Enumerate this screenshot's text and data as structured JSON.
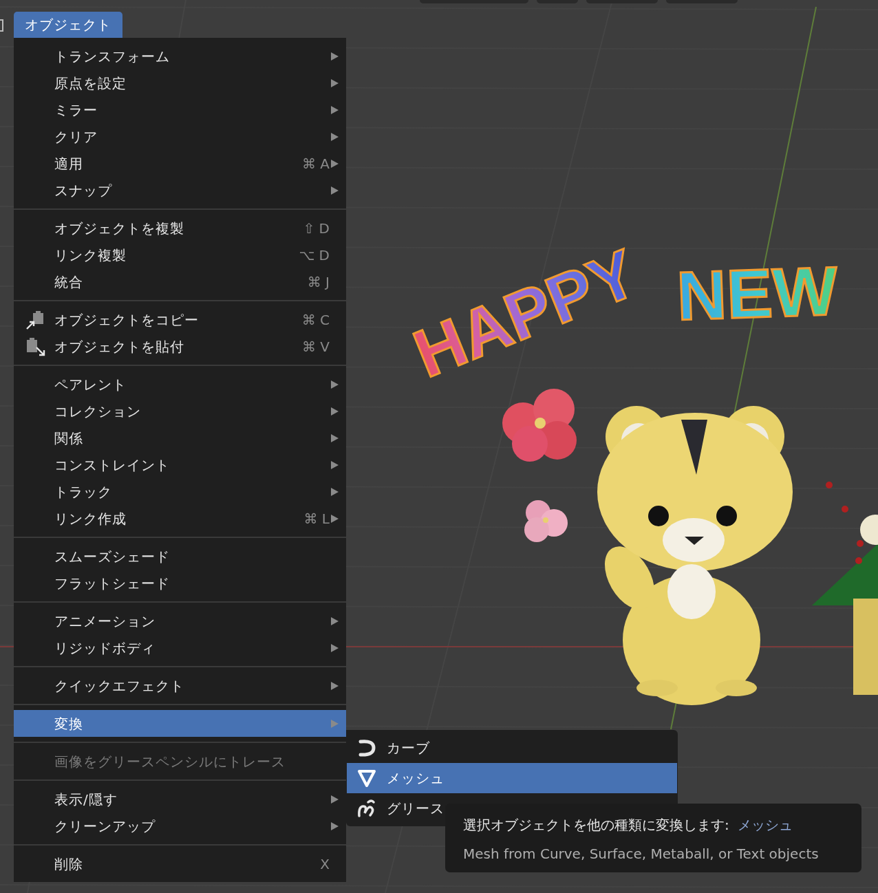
{
  "header_menu": {
    "label": "オブジェクト",
    "selected": true
  },
  "menu": {
    "groups": [
      {
        "items": [
          {
            "label": "トランスフォーム",
            "submenu": true,
            "selected": false,
            "disabled": false
          },
          {
            "label": "原点を設定",
            "submenu": true,
            "selected": false,
            "disabled": false
          },
          {
            "label": "ミラー",
            "submenu": true,
            "selected": false,
            "disabled": false
          },
          {
            "label": "クリア",
            "submenu": true,
            "selected": false,
            "disabled": false
          },
          {
            "label": "適用",
            "shortcut": "⌘ A",
            "submenu": true,
            "selected": false,
            "disabled": false
          },
          {
            "label": "スナップ",
            "submenu": true,
            "selected": false,
            "disabled": false
          }
        ]
      },
      {
        "items": [
          {
            "label": "オブジェクトを複製",
            "shortcut": "⇧ D",
            "submenu": false,
            "selected": false,
            "disabled": false
          },
          {
            "label": "リンク複製",
            "shortcut": "⌥ D",
            "submenu": false,
            "selected": false,
            "disabled": false
          },
          {
            "label": "統合",
            "shortcut": "⌘ J",
            "submenu": false,
            "selected": false,
            "disabled": false
          }
        ]
      },
      {
        "items": [
          {
            "label": "オブジェクトをコピー",
            "shortcut": "⌘ C",
            "submenu": false,
            "selected": false,
            "disabled": false,
            "kind": "copy"
          },
          {
            "label": "オブジェクトを貼付",
            "shortcut": "⌘ V",
            "submenu": false,
            "selected": false,
            "disabled": false,
            "kind": "paste"
          }
        ]
      },
      {
        "items": [
          {
            "label": "ペアレント",
            "submenu": true,
            "selected": false,
            "disabled": false
          },
          {
            "label": "コレクション",
            "submenu": true,
            "selected": false,
            "disabled": false
          },
          {
            "label": "関係",
            "submenu": true,
            "selected": false,
            "disabled": false
          },
          {
            "label": "コンストレイント",
            "submenu": true,
            "selected": false,
            "disabled": false
          },
          {
            "label": "トラック",
            "submenu": true,
            "selected": false,
            "disabled": false
          },
          {
            "label": "リンク作成",
            "shortcut": "⌘ L",
            "submenu": true,
            "selected": false,
            "disabled": false
          }
        ]
      },
      {
        "items": [
          {
            "label": "スムーズシェード",
            "submenu": false,
            "selected": false,
            "disabled": false
          },
          {
            "label": "フラットシェード",
            "submenu": false,
            "selected": false,
            "disabled": false
          }
        ]
      },
      {
        "items": [
          {
            "label": "アニメーション",
            "submenu": true,
            "selected": false,
            "disabled": false
          },
          {
            "label": "リジッドボディ",
            "submenu": true,
            "selected": false,
            "disabled": false
          }
        ]
      },
      {
        "items": [
          {
            "label": "クイックエフェクト",
            "submenu": true,
            "selected": false,
            "disabled": false
          }
        ]
      },
      {
        "items": [
          {
            "label": "変換",
            "submenu": true,
            "selected": true,
            "disabled": false
          }
        ]
      },
      {
        "items": [
          {
            "label": "画像をグリースペンシルにトレース",
            "submenu": false,
            "selected": false,
            "disabled": true
          }
        ]
      },
      {
        "items": [
          {
            "label": "表示/隠す",
            "submenu": true,
            "selected": false,
            "disabled": false
          },
          {
            "label": "クリーンアップ",
            "submenu": true,
            "selected": false,
            "disabled": false
          }
        ]
      },
      {
        "items": [
          {
            "label": "削除",
            "shortcut": "X",
            "submenu": false,
            "selected": false,
            "disabled": false
          }
        ]
      }
    ]
  },
  "submenu": {
    "items": [
      {
        "label": "カーブ",
        "kind": "curve",
        "selected": false
      },
      {
        "label": "メッシュ",
        "kind": "mesh",
        "selected": true
      },
      {
        "label": "グリース",
        "kind": "pencil",
        "selected": false
      }
    ]
  },
  "tooltip": {
    "text": "選択オブジェクトを他の種類に変換します:",
    "value": "メッシュ",
    "detail": "Mesh from Curve, Surface, Metaball, or Text objects"
  },
  "viewport": {
    "scene_text": [
      "HAPPY",
      "NEW"
    ]
  }
}
